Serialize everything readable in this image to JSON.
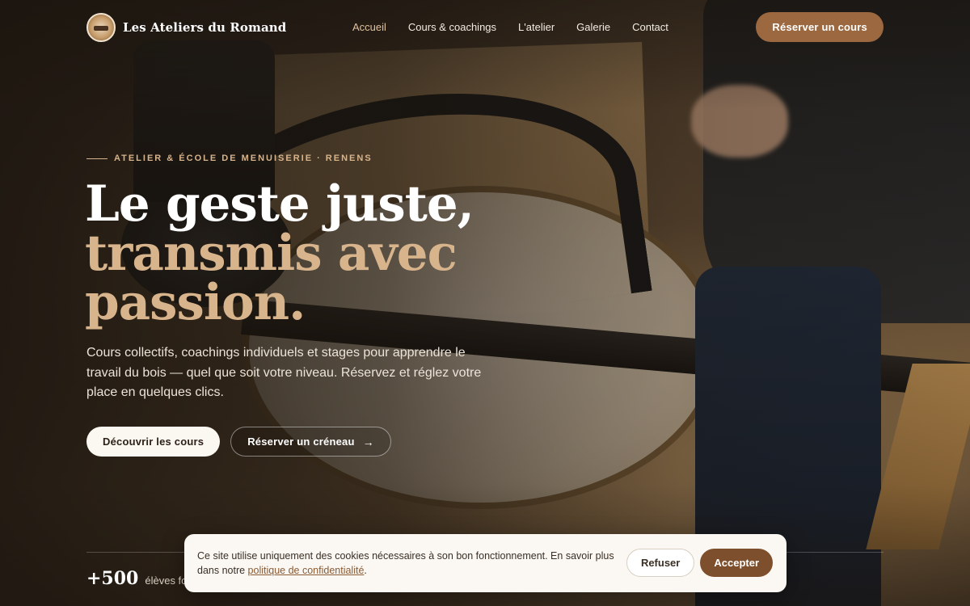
{
  "brand": {
    "name": "Les Ateliers du Romand",
    "logo_icon": "workshop-badge-logo"
  },
  "nav": {
    "items": [
      {
        "label": "Accueil",
        "active": true
      },
      {
        "label": "Cours & coachings",
        "active": false
      },
      {
        "label": "L'atelier",
        "active": false
      },
      {
        "label": "Galerie",
        "active": false
      },
      {
        "label": "Contact",
        "active": false
      }
    ],
    "cta_label": "Réserver un cours"
  },
  "hero": {
    "eyebrow": "ATELIER & ÉCOLE DE MENUISERIE · RENENS",
    "title_line1": "Le geste juste,",
    "title_line2": "transmis avec passion.",
    "subtitle": "Cours collectifs, coachings individuels et stages pour apprendre le travail du bois — quel que soit votre niveau. Réservez et réglez votre place en quelques clics.",
    "primary_cta": "Découvrir les cours",
    "secondary_cta": "Réserver un créneau",
    "secondary_cta_icon": "arrow-right-icon"
  },
  "stats": [
    {
      "value": "+500",
      "label": "élèves formés"
    }
  ],
  "cookie_banner": {
    "text": "Ce site utilise uniquement des cookies nécessaires à son bon fonctionnement. En savoir plus dans notre ",
    "link_label": "politique de confidentialité",
    "text_end": ".",
    "refuse_label": "Refuser",
    "accept_label": "Accepter"
  },
  "colors": {
    "accent": "#9c6840",
    "accent_light": "#d7b48c",
    "accept_button": "#7d4f2d",
    "cookie_bg": "#fbf8f3"
  }
}
